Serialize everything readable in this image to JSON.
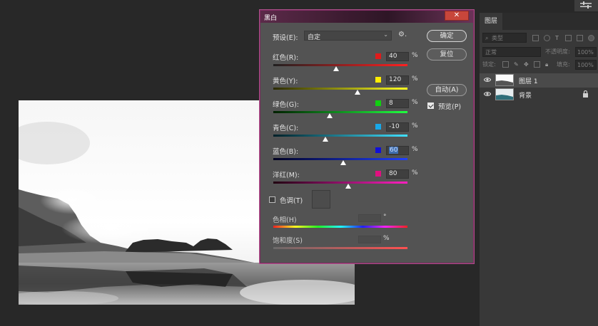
{
  "dialog": {
    "title": "黑白",
    "close_glyph": "✕",
    "preset_label": "预设(E):",
    "preset_value": "自定",
    "sliders": [
      {
        "id": "reds",
        "label": "红色(R):",
        "value": "40",
        "unit": "%",
        "color": "#e01b1b",
        "ramp": [
          "#202020",
          "#ff2020"
        ],
        "level": 0.47
      },
      {
        "id": "yellows",
        "label": "黄色(Y):",
        "value": "120",
        "unit": "%",
        "color": "#ffee00",
        "ramp": [
          "#2a2a00",
          "#ffff20"
        ],
        "level": 0.63
      },
      {
        "id": "greens",
        "label": "绿色(G):",
        "value": "8",
        "unit": "%",
        "color": "#10d010",
        "ramp": [
          "#002000",
          "#20ff40"
        ],
        "level": 0.42
      },
      {
        "id": "cyans",
        "label": "青色(C):",
        "value": "-10",
        "unit": "%",
        "color": "#18a8e8",
        "ramp": [
          "#002028",
          "#40e0ff"
        ],
        "level": 0.39
      },
      {
        "id": "blues",
        "label": "蓝色(B):",
        "value": "60",
        "unit": "%",
        "color": "#1010d8",
        "ramp": [
          "#000020",
          "#2040ff"
        ],
        "level": 0.52
      },
      {
        "id": "magentas",
        "label": "洋红(M):",
        "value": "80",
        "unit": "%",
        "color": "#e01080",
        "ramp": [
          "#200010",
          "#ff20c0"
        ],
        "level": 0.56
      }
    ],
    "tint_label": "色调(T)",
    "hue_label": "色相(H)",
    "hue_unit": "°",
    "saturation_label": "饱和度(S)",
    "saturation_unit": "%",
    "buttons": {
      "ok": "确定",
      "reset": "复位",
      "auto": "自动(A)"
    },
    "preview_label": "预览(P)",
    "preview_checked": true,
    "tint_checked": false
  },
  "layers_panel": {
    "tab": "图层",
    "search_placeholder": "类型",
    "blend_mode": "正常",
    "opacity_label": "不透明度:",
    "opacity_value": "100%",
    "lock_label": "锁定:",
    "fill_label": "填充:",
    "fill_value": "100%",
    "layers": [
      {
        "name": "图层 1",
        "selected": true,
        "visible": true,
        "locked": false
      },
      {
        "name": "背景",
        "selected": false,
        "visible": true,
        "locked": true
      }
    ]
  },
  "colors": {
    "accent_border": "#b0508c",
    "close_button": "#c8463b"
  }
}
